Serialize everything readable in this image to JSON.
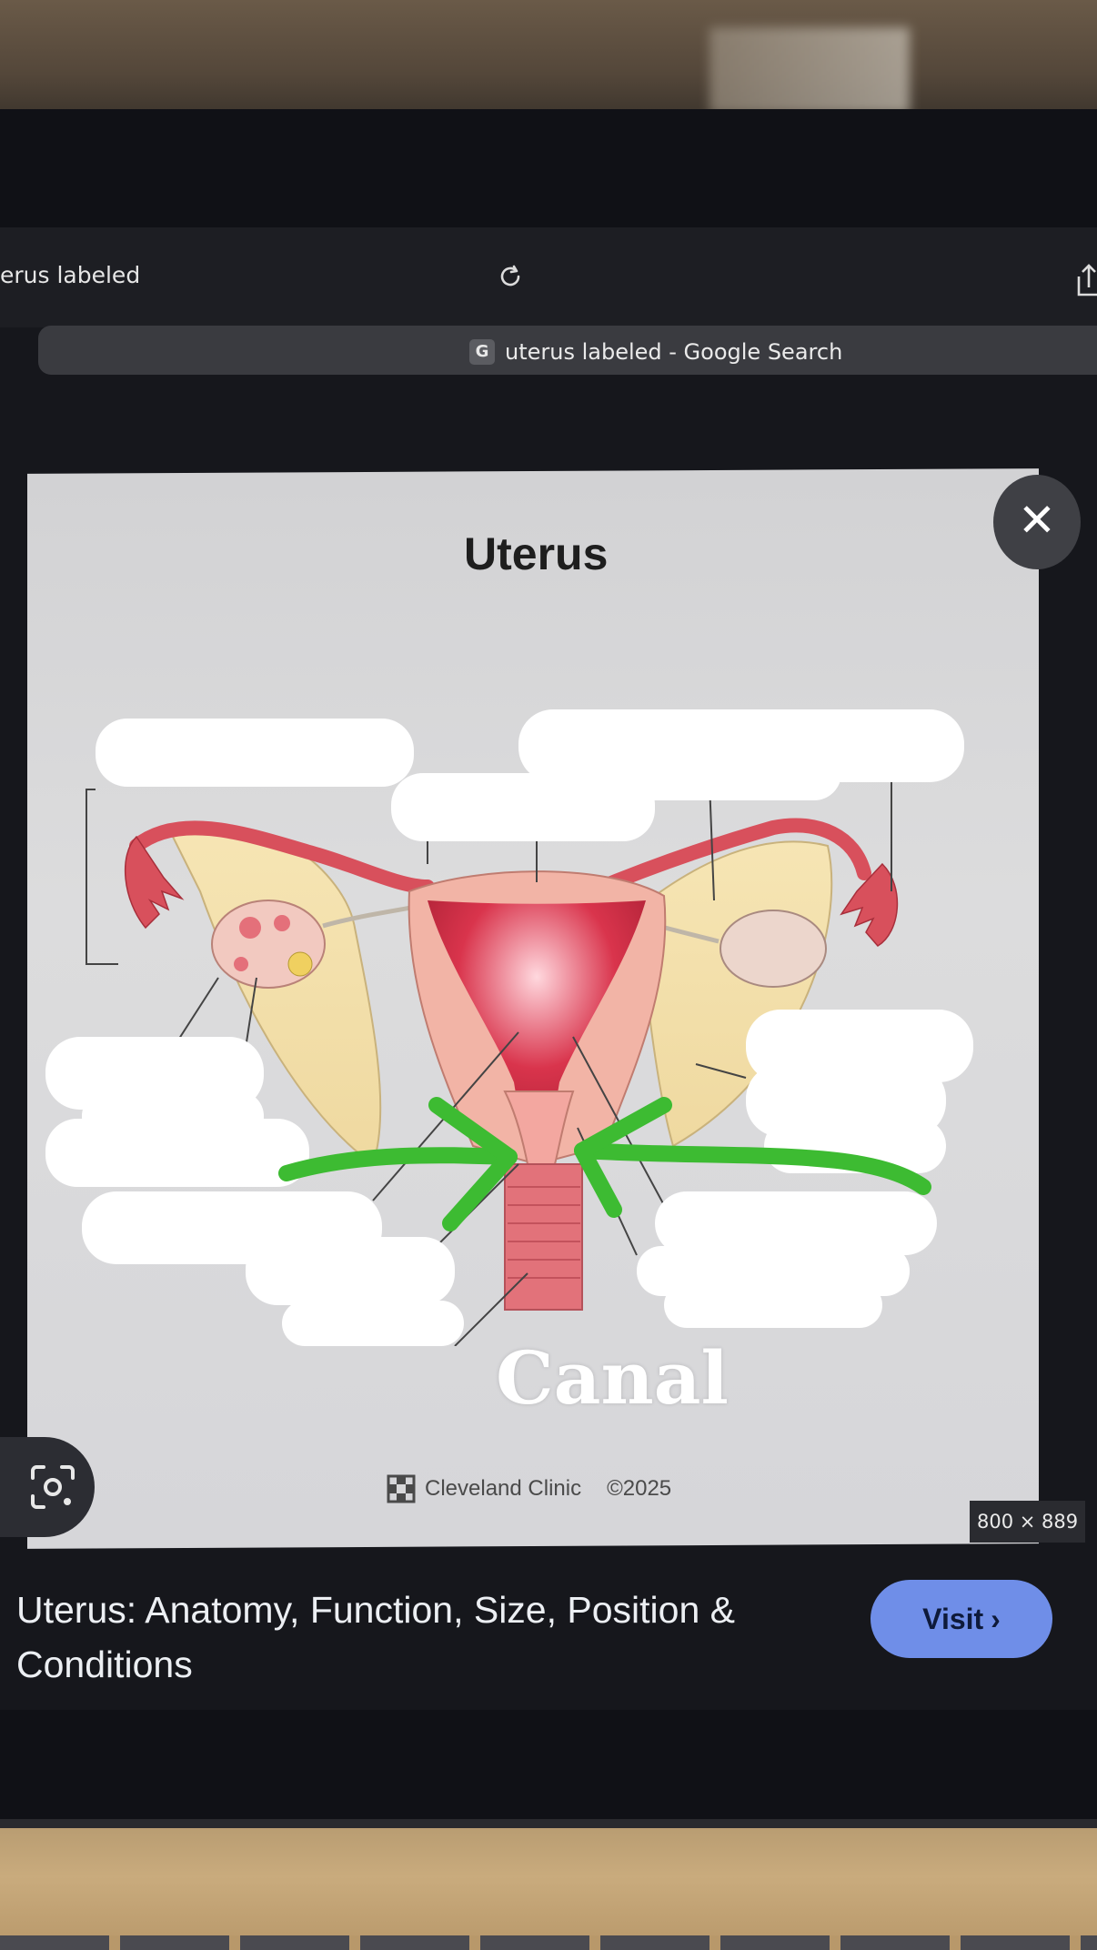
{
  "browser": {
    "address_text": "erus labeled",
    "tab_favicon": "G",
    "tab_title": "uterus labeled - Google Search"
  },
  "image_viewer": {
    "diagram_title": "Uterus",
    "overlay_word": "Canal",
    "credit_brand": "Cleveland Clinic",
    "credit_year": "©2025",
    "dimensions": "800 × 889",
    "close_symbol": "✕",
    "icons": [
      "close-icon",
      "lens-icon",
      "reload-icon",
      "share-icon"
    ]
  },
  "result": {
    "title": "Uterus: Anatomy, Function, Size, Position & Conditions",
    "visit_label": "Visit",
    "visit_arrow": "›"
  },
  "colors": {
    "annotation_arrow": "#3dbb32",
    "visit_button": "#6f8ee8",
    "uterus_tissue": "#e58a88"
  }
}
